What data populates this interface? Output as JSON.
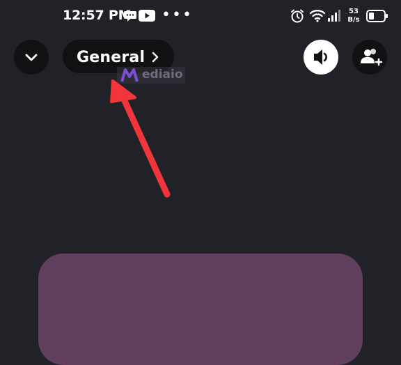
{
  "status_bar": {
    "time": "12:57 PM",
    "dots": "•••",
    "network_speed_value": "53",
    "network_speed_unit": "B/s"
  },
  "header": {
    "channel_name": "General"
  },
  "watermark": {
    "text": "ediaio"
  },
  "colors": {
    "background": "#212128",
    "button_dark": "#111114",
    "button_light": "#ffffff",
    "video_tile": "#613f5e",
    "annotation_arrow": "#f2343b"
  },
  "icons": {
    "collapse": "chevron-down-icon",
    "channel_chevron": "chevron-right-icon",
    "speaker": "speaker-icon",
    "add_user": "add-user-icon"
  }
}
